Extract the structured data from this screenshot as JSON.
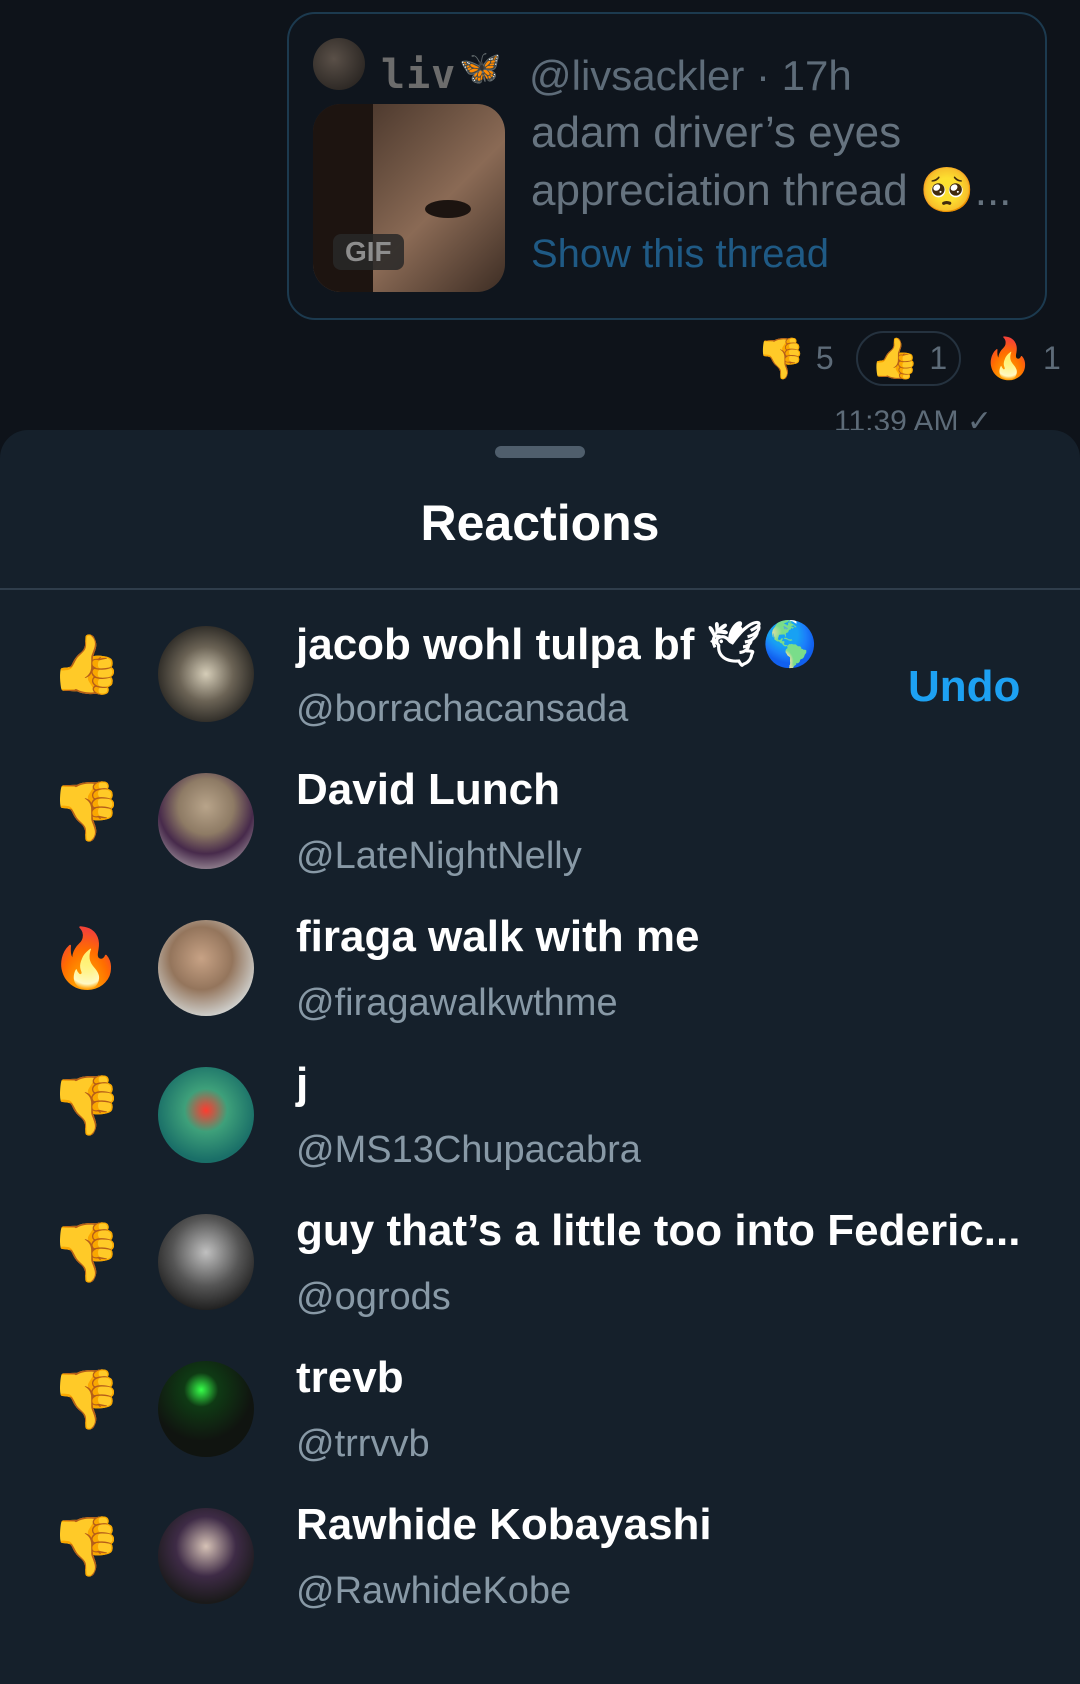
{
  "quoted_tweet": {
    "name": "liv",
    "butterfly_emoji": "🦋",
    "handle_time": "@livsackler · 17h",
    "text": "adam driver’s eyes appreciation thread 🥺...",
    "gif_label": "GIF",
    "link": "Show this thread"
  },
  "reaction_summary": [
    {
      "emoji": "👎",
      "count": "5",
      "mine": false
    },
    {
      "emoji": "👍",
      "count": "1",
      "mine": true
    },
    {
      "emoji": "🔥",
      "count": "1",
      "mine": false
    }
  ],
  "timestamp": "11:39 AM ✓",
  "sheet": {
    "title": "Reactions",
    "undo_label": "Undo",
    "rows": [
      {
        "emoji": "👍",
        "name": "jacob wohl tulpa bf 🕊🌎",
        "handle": "@borrachacansada"
      },
      {
        "emoji": "👎",
        "name": "David Lunch",
        "handle": "@LateNightNelly"
      },
      {
        "emoji": "🔥",
        "name": "firaga walk with me",
        "handle": "@firagawalkwthme"
      },
      {
        "emoji": "👎",
        "name": "j",
        "handle": "@MS13Chupacabra"
      },
      {
        "emoji": "👎",
        "name": "guy that’s a little too into Federic...",
        "handle": "@ogrods"
      },
      {
        "emoji": "👎",
        "name": "trevb",
        "handle": "@trrvvb"
      },
      {
        "emoji": "👎",
        "name": "Rawhide Kobayashi",
        "handle": "@RawhideKobe"
      }
    ]
  }
}
